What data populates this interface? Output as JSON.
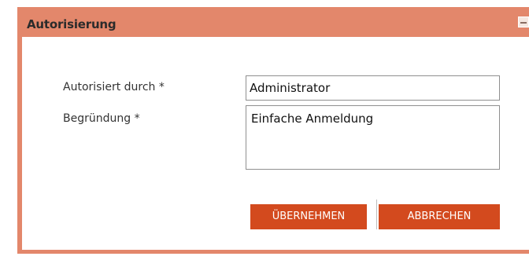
{
  "dialog": {
    "title": "Autorisierung",
    "minimize_icon": "minimize-icon",
    "colors": {
      "frame": "#e3876b",
      "button": "#d34a1e",
      "button_text": "#ffffff"
    }
  },
  "form": {
    "authorized_by_label": "Autorisiert durch *",
    "authorized_by_value": "Administrator",
    "reason_label": "Begründung *",
    "reason_value": "Einfache Anmeldung"
  },
  "buttons": {
    "apply_label": "ÜBERNEHMEN",
    "cancel_label": "ABBRECHEN"
  }
}
